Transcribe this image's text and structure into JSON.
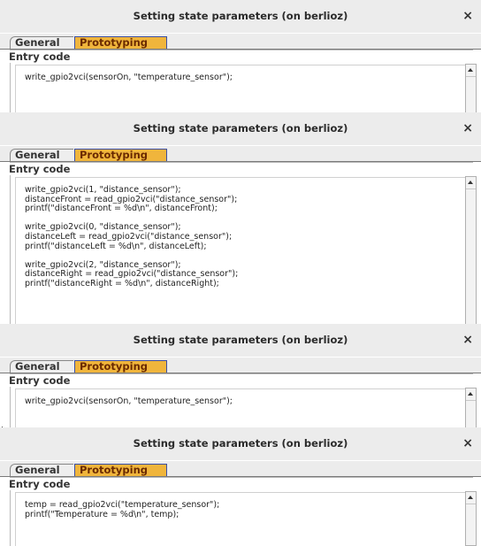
{
  "panels": [
    {
      "title": "Setting state parameters (on berlioz)",
      "close_symbol": "×",
      "tabs": [
        "General",
        "Prototyping"
      ],
      "section_label": "Entry code",
      "code": "write_gpio2vci(sensorOn, \"temperature_sensor\");"
    },
    {
      "title": "Setting state parameters (on berlioz)",
      "close_symbol": "×",
      "tabs": [
        "General",
        "Prototyping"
      ],
      "section_label": "Entry code",
      "code": "write_gpio2vci(1, \"distance_sensor\");\ndistanceFront = read_gpio2vci(\"distance_sensor\");\nprintf(\"distanceFront = %d\\n\", distanceFront);\n\nwrite_gpio2vci(0, \"distance_sensor\");\ndistanceLeft = read_gpio2vci(\"distance_sensor\");\nprintf(\"distanceLeft = %d\\n\", distanceLeft);\n\nwrite_gpio2vci(2, \"distance_sensor\");\ndistanceRight = read_gpio2vci(\"distance_sensor\");\nprintf(\"distanceRight = %d\\n\", distanceRight);"
    },
    {
      "title": "Setting state parameters (on berlioz)",
      "close_symbol": "×",
      "tabs": [
        "General",
        "Prototyping"
      ],
      "section_label": "Entry code",
      "code": "write_gpio2vci(sensorOn, \"temperature_sensor\");"
    },
    {
      "title": "Setting state parameters (on berlioz)",
      "close_symbol": "×",
      "tabs": [
        "General",
        "Prototyping"
      ],
      "section_label": "Entry code",
      "code": "temp = read_gpio2vci(\"temperature_sensor\");\nprintf(\"Temperature = %d\\n\", temp);"
    }
  ],
  "colors": {
    "title_bar": "#ececec",
    "active_tab": "#f0b53c",
    "active_tab_text": "#6b2a00",
    "active_tab_border": "#3b4fa5"
  },
  "icons": [
    "close-icon",
    "scroll-up-arrow-icon"
  ]
}
